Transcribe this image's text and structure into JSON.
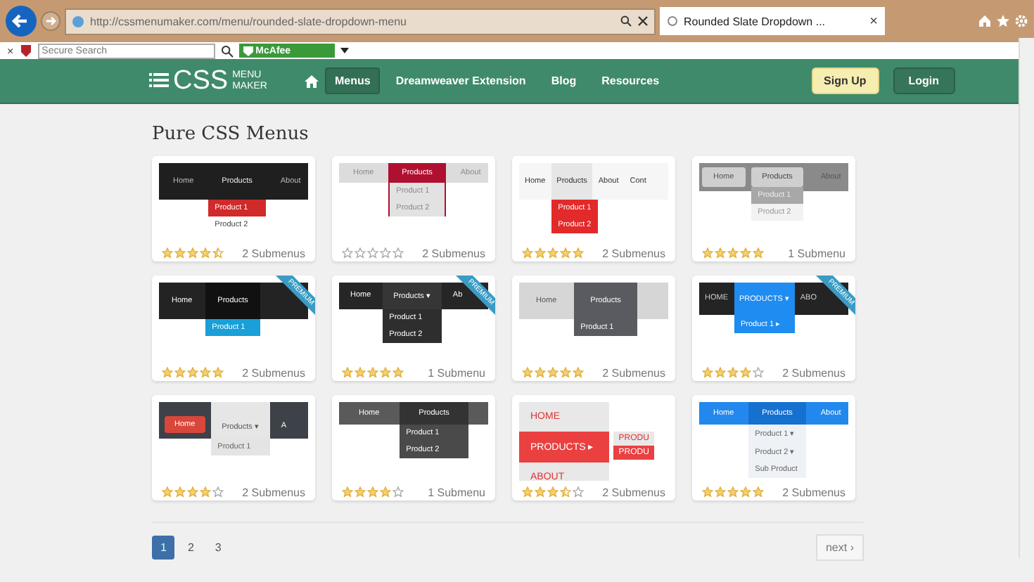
{
  "browser": {
    "url": "http://cssmenumaker.com/menu/rounded-slate-dropdown-menu",
    "tab": {
      "title": "Rounded Slate Dropdown ...",
      "close": "×"
    },
    "toolbar": {
      "close": "×",
      "search_placeholder": "Secure Search",
      "addon": "McAfee"
    }
  },
  "header": {
    "logo": {
      "main": "CSS",
      "top": "MENU",
      "bottom": "MAKER"
    },
    "nav": [
      {
        "label": "Menus",
        "selected": true
      },
      {
        "label": "Dreamweaver Extension",
        "selected": false
      },
      {
        "label": "Blog",
        "selected": false
      },
      {
        "label": "Resources",
        "selected": false
      }
    ],
    "signup": "Sign Up",
    "login": "Login"
  },
  "title": "Pure CSS Menus",
  "cards": [
    {
      "thumb": {
        "kind": "dark",
        "bar": [
          {
            "label": "Home",
            "selected": false
          },
          {
            "label": "Products",
            "selected": true
          },
          {
            "label": "About",
            "selected": false
          }
        ],
        "drop": [
          "Product 1",
          "Product 2"
        ]
      },
      "stars": 4.5,
      "submenus": "2 Submenus"
    },
    {
      "thumb": {
        "kind": "crimson",
        "bar": [
          {
            "label": "Home",
            "selected": false
          },
          {
            "label": "Products",
            "selected": true
          },
          {
            "label": "About",
            "selected": false
          }
        ],
        "drop": [
          "Product 1",
          "Product 2"
        ]
      },
      "stars": 0,
      "submenus": "2 Submenus"
    },
    {
      "thumb": {
        "kind": "light-red",
        "bar": [
          {
            "label": "Home",
            "selected": false
          },
          {
            "label": "Products",
            "selected": true
          },
          {
            "label": "About",
            "selected": false
          },
          {
            "label": "Cont",
            "selected": false
          }
        ],
        "drop": [
          "Product 1",
          "Product 2"
        ]
      },
      "stars": 5,
      "submenus": "2 Submenus"
    },
    {
      "thumb": {
        "kind": "silver",
        "bar": [
          {
            "label": "Home",
            "selected": false
          },
          {
            "label": "Products",
            "selected": true
          },
          {
            "label": "About",
            "selected": false
          }
        ],
        "drop": [
          "Product 1",
          "Product 2"
        ]
      },
      "stars": 5,
      "submenus": "1 Submenu"
    },
    {
      "thumb": {
        "kind": "black-blue",
        "bar": [
          {
            "label": "Home",
            "selected": false
          },
          {
            "label": "Products",
            "selected": true
          }
        ],
        "drop": [
          "Product 1"
        ]
      },
      "premium": "PREMIUM",
      "stars": 5,
      "submenus": "2 Submenus"
    },
    {
      "thumb": {
        "kind": "black",
        "bar": [
          {
            "label": "Home",
            "selected": false
          },
          {
            "label": "Products ▾",
            "selected": true
          },
          {
            "label": "Ab",
            "selected": false
          }
        ],
        "drop": [
          "Product 1",
          "Product 2"
        ]
      },
      "premium": "PREMIUM",
      "stars": 5,
      "submenus": "1 Submenu"
    },
    {
      "thumb": {
        "kind": "grey",
        "bar": [
          {
            "label": "Home",
            "selected": false
          },
          {
            "label": "Products",
            "selected": true
          }
        ],
        "drop": [
          "Product 1"
        ]
      },
      "stars": 5,
      "submenus": "2 Submenus"
    },
    {
      "thumb": {
        "kind": "blue",
        "bar": [
          {
            "label": "HOME",
            "selected": false
          },
          {
            "label": "PRODUCTS ▾",
            "selected": true
          },
          {
            "label": "ABO",
            "selected": false
          }
        ],
        "drop": [
          "Product 1 ▸"
        ]
      },
      "premium": "PREMIUM",
      "stars": 4,
      "submenus": "2 Submenus"
    },
    {
      "thumb": {
        "kind": "slate",
        "bar": [
          {
            "label": "Home",
            "selected": false
          },
          {
            "label": "Products ▾",
            "selected": true
          },
          {
            "label": "A",
            "selected": false
          }
        ],
        "drop": [
          "Product 1"
        ]
      },
      "stars": 4,
      "submenus": "2 Submenus"
    },
    {
      "thumb": {
        "kind": "charcoal",
        "bar": [
          {
            "label": "Home",
            "selected": false
          },
          {
            "label": "Products",
            "selected": true
          }
        ],
        "drop": [
          "Product 1",
          "Product 2"
        ]
      },
      "stars": 4,
      "submenus": "1 Submenu"
    },
    {
      "thumb": {
        "kind": "red-vertical",
        "bar": [
          {
            "label": "HOME",
            "selected": false
          },
          {
            "label": "PRODUCTS ▸",
            "selected": true
          },
          {
            "label": "ABOUT",
            "selected": false
          }
        ],
        "drop": [
          "PRODU",
          "PRODU"
        ]
      },
      "stars": 3.5,
      "submenus": "2 Submenus"
    },
    {
      "thumb": {
        "kind": "blue-flat",
        "bar": [
          {
            "label": "Home",
            "selected": false
          },
          {
            "label": "Products",
            "selected": true
          },
          {
            "label": "About",
            "selected": false
          }
        ],
        "drop": [
          "Product 1 ▾",
          "Product 2 ▾",
          "Sub Product"
        ]
      },
      "stars": 5,
      "submenus": "2 Submenus"
    }
  ],
  "pager": {
    "pages": [
      {
        "label": "1",
        "selected": true
      },
      {
        "label": "2",
        "selected": false
      },
      {
        "label": "3",
        "selected": false
      }
    ],
    "next": "next ›"
  }
}
